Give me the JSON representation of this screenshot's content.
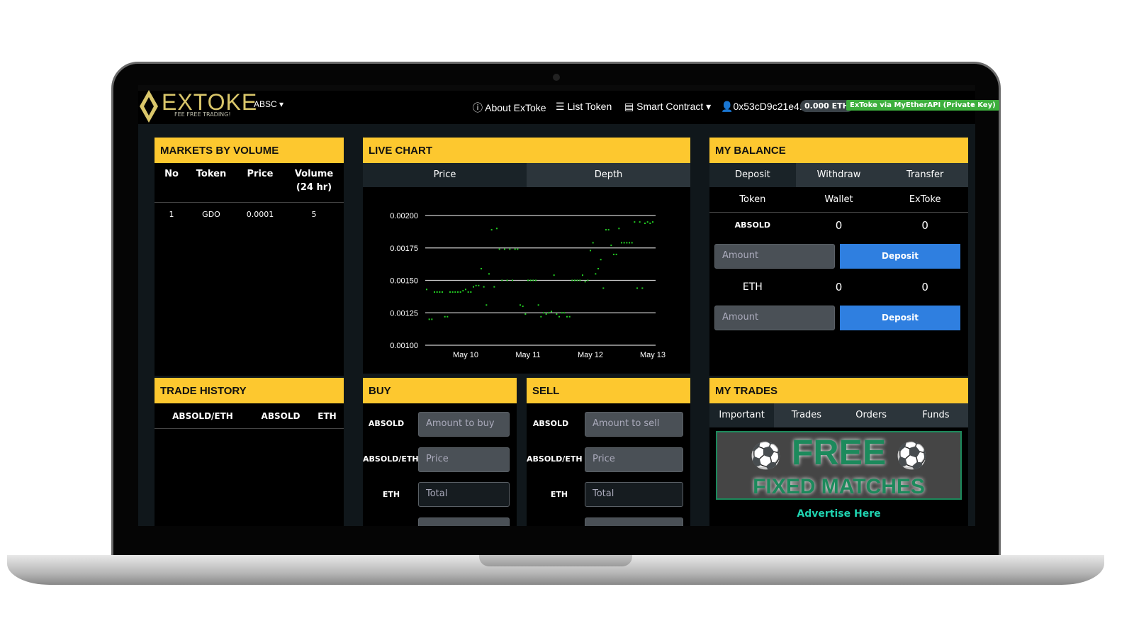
{
  "brand": {
    "logo_text": "EXTOKE",
    "tagline": "FEE FREE TRADING!",
    "accent": "#fdc82f"
  },
  "nav": {
    "market_select": "ABSC ▾",
    "about": "About ExToke",
    "list_token": "List Token",
    "smart_contract": "Smart Contract ▾",
    "account": "0x53cD9c21e4...",
    "eth_balance": "0.000 ETH",
    "api_badge": "ExToke via MyEtherAPI (Private Key)",
    "caret": "▾"
  },
  "markets": {
    "title": "MARKETS BY VOLUME",
    "columns": [
      "No",
      "Token",
      "Price",
      "Volume\n(24 hr)"
    ],
    "rows": [
      [
        "1",
        "GDO",
        "0.0001",
        "5"
      ]
    ]
  },
  "live_chart": {
    "title": "LIVE CHART",
    "tabs": [
      "Price",
      "Depth"
    ]
  },
  "balance": {
    "title": "MY BALANCE",
    "tabs": [
      "Deposit",
      "Withdraw",
      "Transfer"
    ],
    "columns": [
      "Token",
      "Wallet",
      "ExToke"
    ],
    "rows": [
      {
        "token": "ABSOLD",
        "wallet": "0",
        "extoke": "0",
        "placeholder": "Amount",
        "button": "Deposit"
      },
      {
        "token": "ETH",
        "wallet": "0",
        "extoke": "0",
        "placeholder": "Amount",
        "button": "Deposit"
      }
    ]
  },
  "trade_history": {
    "title": "TRADE HISTORY",
    "columns": [
      "ABSOLD/ETH",
      "ABSOLD",
      "ETH"
    ]
  },
  "buy": {
    "title": "BUY",
    "fields": [
      {
        "label": "ABSOLD",
        "placeholder": "Amount to buy"
      },
      {
        "label": "ABSOLD/ETH",
        "placeholder": "Price"
      },
      {
        "label": "ETH",
        "placeholder": "Total"
      }
    ]
  },
  "sell": {
    "title": "SELL",
    "fields": [
      {
        "label": "ABSOLD",
        "placeholder": "Amount to sell"
      },
      {
        "label": "ABSOLD/ETH",
        "placeholder": "Price"
      },
      {
        "label": "ETH",
        "placeholder": "Total"
      }
    ]
  },
  "my_trades": {
    "title": "MY TRADES",
    "tabs": [
      "Important",
      "Trades",
      "Orders",
      "Funds"
    ],
    "ad_line1": "FREE",
    "ad_line2": "FIXED MATCHES",
    "advertise": "Advertise Here"
  },
  "chart_data": {
    "type": "scatter",
    "title": "",
    "xlabel": "",
    "ylabel": "",
    "ylim": [
      0.001,
      0.002
    ],
    "yticks": [
      "0.00100",
      "0.00125",
      "0.00150",
      "0.00175",
      "0.00200"
    ],
    "xticks": [
      "May 10",
      "May 11",
      "May 12",
      "May 13"
    ],
    "grid": true,
    "color": "#22cc22",
    "points": [
      [
        "May 9 09:00",
        0.00143
      ],
      [
        "May 9 10:00",
        0.0012
      ],
      [
        "May 9 11:00",
        0.0012
      ],
      [
        "May 9 12:00",
        0.00141
      ],
      [
        "May 9 13:00",
        0.00141
      ],
      [
        "May 9 14:00",
        0.00141
      ],
      [
        "May 9 15:00",
        0.00141
      ],
      [
        "May 9 16:00",
        0.00122
      ],
      [
        "May 9 17:00",
        0.00122
      ],
      [
        "May 9 18:00",
        0.00141
      ],
      [
        "May 9 19:00",
        0.00141
      ],
      [
        "May 9 20:00",
        0.00141
      ],
      [
        "May 9 21:00",
        0.00141
      ],
      [
        "May 9 22:00",
        0.00141
      ],
      [
        "May 9 23:00",
        0.00142
      ],
      [
        "May 10 00:00",
        0.00143
      ],
      [
        "May 10 01:00",
        0.00141
      ],
      [
        "May 10 02:00",
        0.00141
      ],
      [
        "May 10 03:00",
        0.00145
      ],
      [
        "May 10 04:00",
        0.00146
      ],
      [
        "May 10 05:00",
        0.00146
      ],
      [
        "May 10 06:00",
        0.00159
      ],
      [
        "May 10 07:00",
        0.00145
      ],
      [
        "May 10 08:00",
        0.00131
      ],
      [
        "May 10 09:00",
        0.00155
      ],
      [
        "May 10 10:00",
        0.00189
      ],
      [
        "May 10 11:00",
        0.00145
      ],
      [
        "May 10 12:00",
        0.0019
      ],
      [
        "May 10 13:00",
        0.00174
      ],
      [
        "May 10 14:00",
        0.0015
      ],
      [
        "May 10 15:00",
        0.00174
      ],
      [
        "May 10 16:00",
        0.0015
      ],
      [
        "May 10 17:00",
        0.00174
      ],
      [
        "May 10 18:00",
        0.0015
      ],
      [
        "May 10 19:00",
        0.00174
      ],
      [
        "May 10 20:00",
        0.00174
      ],
      [
        "May 10 21:00",
        0.00131
      ],
      [
        "May 10 22:00",
        0.0013
      ],
      [
        "May 10 23:00",
        0.00124
      ],
      [
        "May 11 00:00",
        0.0015
      ],
      [
        "May 11 01:00",
        0.0015
      ],
      [
        "May 11 02:00",
        0.0015
      ],
      [
        "May 11 03:00",
        0.0015
      ],
      [
        "May 11 04:00",
        0.00131
      ],
      [
        "May 11 05:00",
        0.00122
      ],
      [
        "May 11 06:00",
        0.00125
      ],
      [
        "May 11 07:00",
        0.00124
      ],
      [
        "May 11 08:00",
        0.00125
      ],
      [
        "May 11 09:00",
        0.00126
      ],
      [
        "May 11 10:00",
        0.00154
      ],
      [
        "May 11 11:00",
        0.00124
      ],
      [
        "May 11 12:00",
        0.00122
      ],
      [
        "May 11 13:00",
        0.00125
      ],
      [
        "May 11 14:00",
        0.00125
      ],
      [
        "May 11 15:00",
        0.00122
      ],
      [
        "May 11 16:00",
        0.00122
      ],
      [
        "May 11 17:00",
        0.0015
      ],
      [
        "May 11 18:00",
        0.0015
      ],
      [
        "May 11 19:00",
        0.0015
      ],
      [
        "May 11 20:00",
        0.0015
      ],
      [
        "May 11 21:00",
        0.00154
      ],
      [
        "May 11 22:00",
        0.00149
      ],
      [
        "May 11 23:00",
        0.0015
      ],
      [
        "May 12 00:00",
        0.00173
      ],
      [
        "May 12 01:00",
        0.00179
      ],
      [
        "May 12 02:00",
        0.00155
      ],
      [
        "May 12 03:00",
        0.00159
      ],
      [
        "May 12 04:00",
        0.00166
      ],
      [
        "May 12 05:00",
        0.00144
      ],
      [
        "May 12 06:00",
        0.00189
      ],
      [
        "May 12 07:00",
        0.00189
      ],
      [
        "May 12 08:00",
        0.00177
      ],
      [
        "May 12 09:00",
        0.0017
      ],
      [
        "May 12 10:00",
        0.0017
      ],
      [
        "May 12 11:00",
        0.0019
      ],
      [
        "May 12 12:00",
        0.00179
      ],
      [
        "May 12 13:00",
        0.00179
      ],
      [
        "May 12 14:00",
        0.00179
      ],
      [
        "May 12 15:00",
        0.00179
      ],
      [
        "May 12 16:00",
        0.00179
      ],
      [
        "May 12 17:00",
        0.00195
      ],
      [
        "May 12 18:00",
        0.00144
      ],
      [
        "May 12 19:00",
        0.00195
      ],
      [
        "May 12 20:00",
        0.00144
      ],
      [
        "May 12 21:00",
        0.00194
      ],
      [
        "May 12 22:00",
        0.00195
      ],
      [
        "May 12 23:00",
        0.00194
      ],
      [
        "May 13 00:00",
        0.00195
      ]
    ]
  }
}
